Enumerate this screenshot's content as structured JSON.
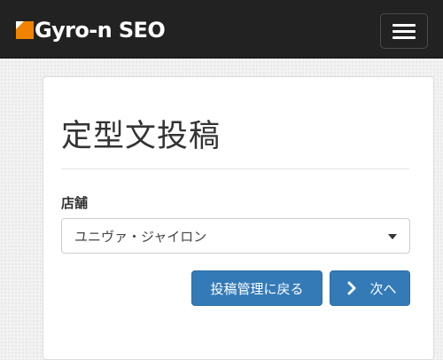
{
  "navbar": {
    "brand": "Gyro-n SEO",
    "menu_icon": "hamburger-menu-icon"
  },
  "page": {
    "title": "定型文投稿"
  },
  "form": {
    "store_label": "店舗",
    "store_selected": "ユニヴァ・ジャイロン"
  },
  "actions": {
    "back_label": "投稿管理に戻る",
    "next_label": "次へ",
    "next_icon": "chevron-right-icon"
  },
  "colors": {
    "navbar_bg": "#222222",
    "brand_accent": "#f08300",
    "primary_button": "#337ab7"
  }
}
